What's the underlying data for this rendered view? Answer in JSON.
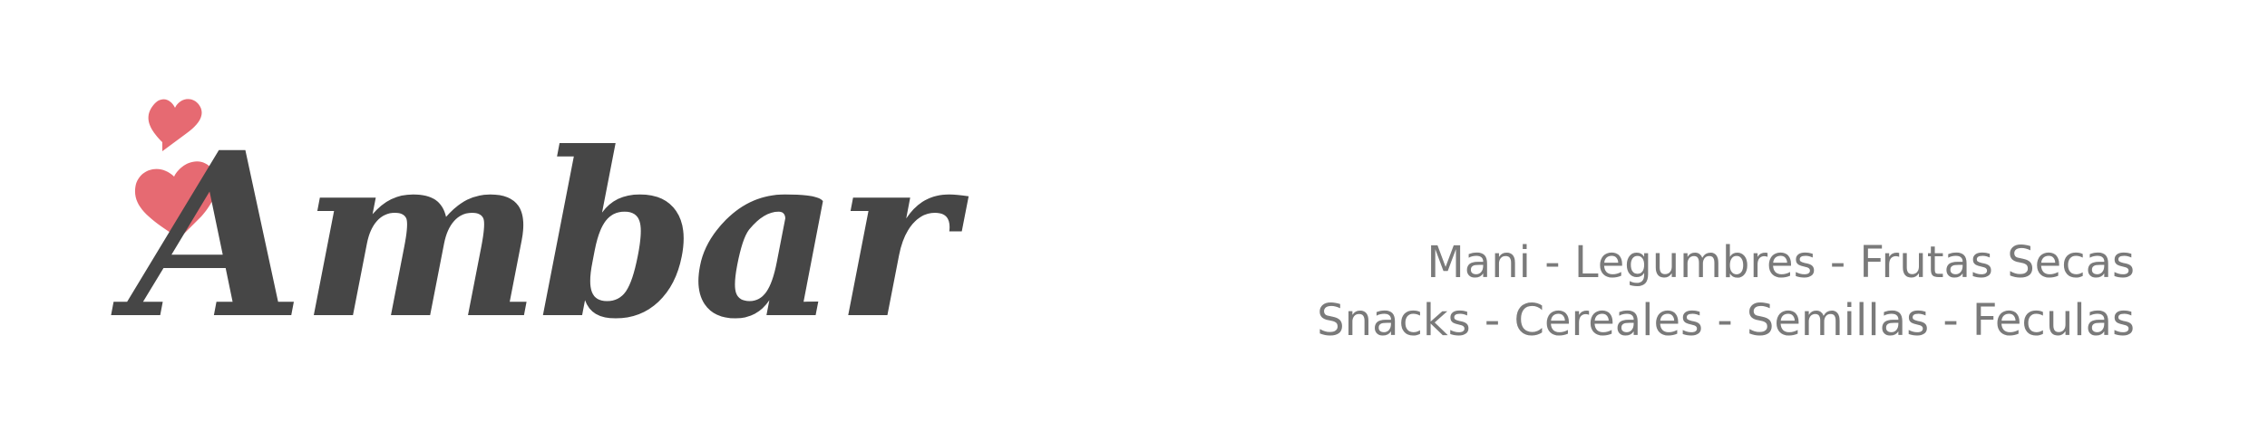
{
  "brand": {
    "name": "Ambar",
    "heart_color": "#e66a72",
    "text_color": "#464646"
  },
  "tagline": {
    "line1": "Mani - Legumbres - Frutas Secas",
    "line2": "Snacks - Cereales - Semillas - Feculas",
    "color": "#7a7a7a"
  }
}
